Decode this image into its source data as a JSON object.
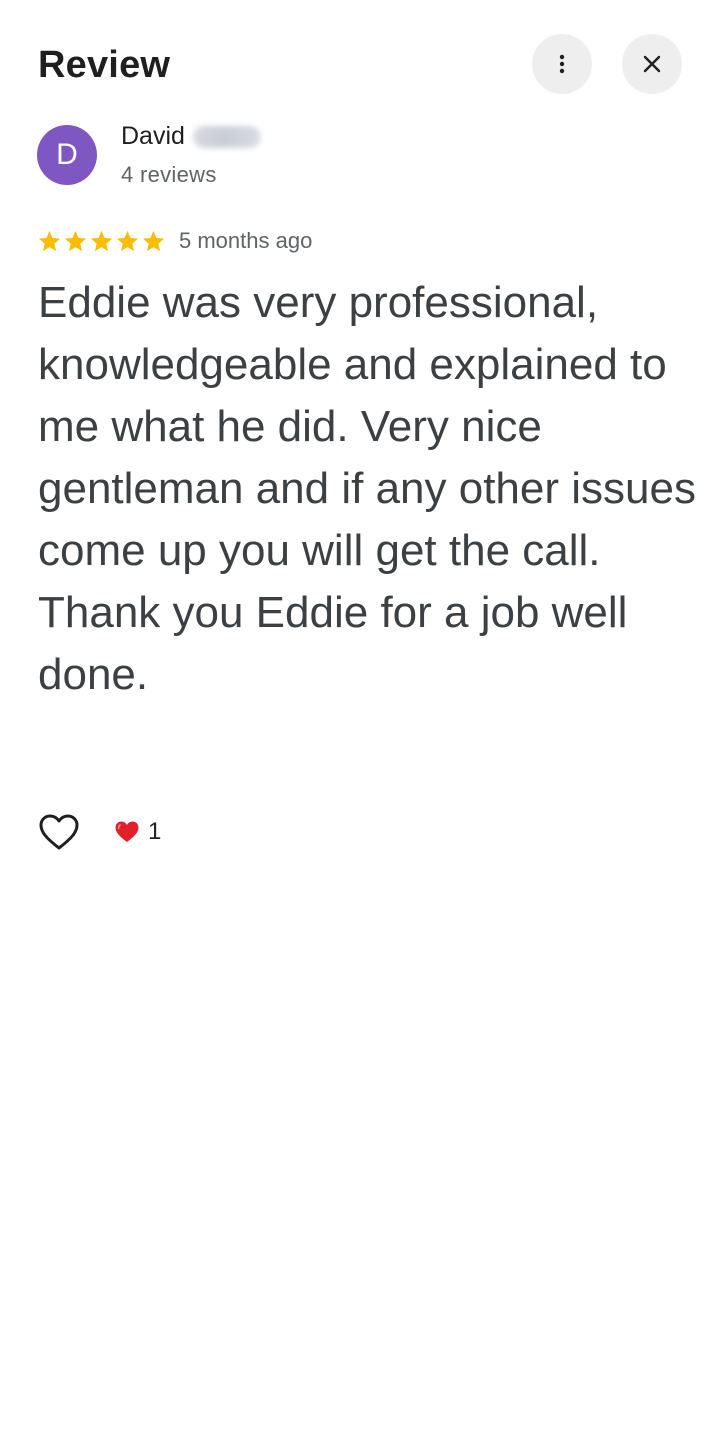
{
  "header": {
    "title": "Review",
    "more_icon": "more-vert-icon",
    "close_icon": "close-icon"
  },
  "author": {
    "initial": "D",
    "name": "David",
    "avatar_color": "#7e57c2",
    "review_count": "4 reviews"
  },
  "review": {
    "rating": 5,
    "max_rating": 5,
    "star_color": "#fbbc04",
    "age": "5 months ago",
    "text": "Eddie was very professional, knowledgeable and explained to me what he did. Very nice gentleman and if any other issues come up you will get the call.\nThank you Eddie for a job well done."
  },
  "reactions": {
    "like_icon": "heart-outline-icon",
    "heart_icon": "red-heart-icon",
    "heart_count": "1"
  }
}
